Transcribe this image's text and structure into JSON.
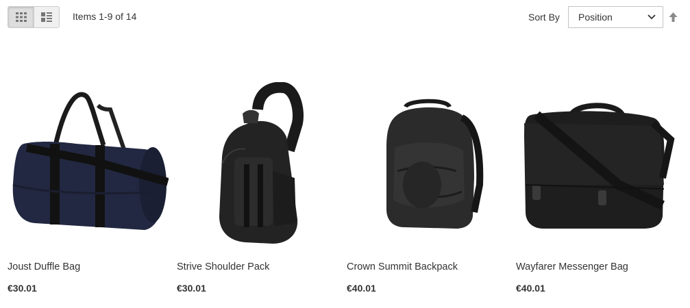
{
  "toolbar": {
    "view_modes": [
      {
        "name": "grid",
        "icon": "grid-icon",
        "active": true
      },
      {
        "name": "list",
        "icon": "list-icon",
        "active": false
      }
    ],
    "amount": "Items 1-9 of 14",
    "sort_label": "Sort By",
    "sort_value": "Position",
    "sort_direction_icon": "arrow-up-icon"
  },
  "products": [
    {
      "name": "Joust Duffle Bag",
      "price": "€30.01",
      "image": "duffle-bag-image"
    },
    {
      "name": "Strive Shoulder Pack",
      "price": "€30.01",
      "image": "shoulder-pack-image"
    },
    {
      "name": "Crown Summit Backpack",
      "price": "€40.01",
      "image": "backpack-image"
    },
    {
      "name": "Wayfarer Messenger Bag",
      "price": "€40.01",
      "image": "messenger-bag-image"
    }
  ],
  "colors": {
    "text": "#333333",
    "border": "#cccccc",
    "icon": "#757575"
  }
}
